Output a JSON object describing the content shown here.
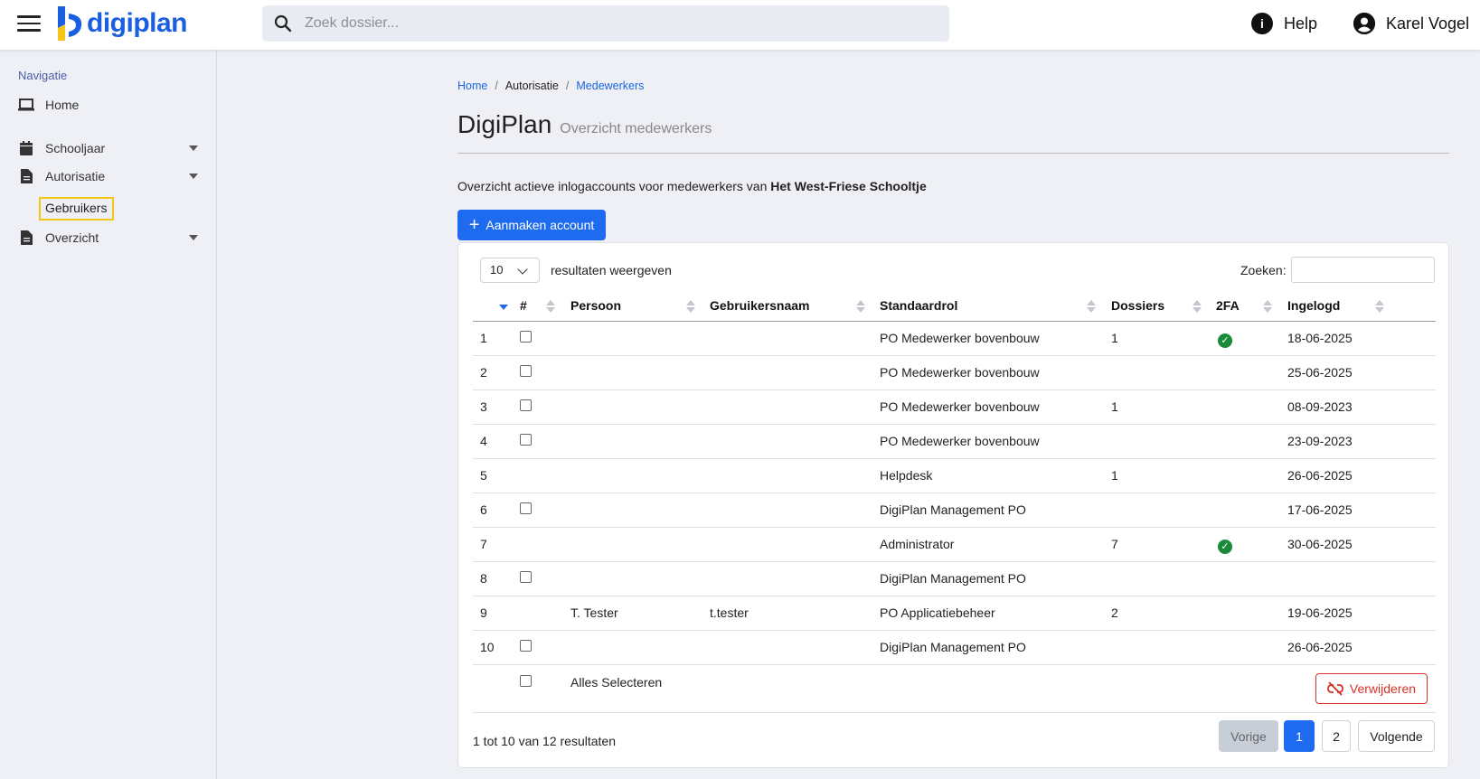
{
  "header": {
    "logo_text": "digiplan",
    "search_placeholder": "Zoek dossier...",
    "help_label": "Help",
    "user_name": "Karel Vogel"
  },
  "sidebar": {
    "heading": "Navigatie",
    "items": [
      {
        "label": "Home",
        "icon": "laptop-icon"
      },
      {
        "label": "Schooljaar",
        "icon": "calendar-icon"
      },
      {
        "label": "Autorisatie",
        "icon": "document-icon"
      },
      {
        "label": "Overzicht",
        "icon": "document-icon"
      }
    ],
    "sub_item": "Gebruikers"
  },
  "breadcrumb": {
    "home": "Home",
    "sep": "/",
    "auth": "Autorisatie",
    "current": "Medewerkers"
  },
  "page": {
    "title": "DigiPlan",
    "subtitle": "Overzicht medewerkers",
    "intro": "Overzicht actieve inlogaccounts voor medewerkers van ",
    "school": "Het West-Friese Schooltje",
    "create_button": "Aanmaken account"
  },
  "table": {
    "length_value": "10",
    "length_label": "resultaten weergeven",
    "search_label": "Zoeken:",
    "headers": {
      "hash": "#",
      "persoon": "Persoon",
      "gebruikersnaam": "Gebruikersnaam",
      "standaardrol": "Standaardrol",
      "dossiers": "Dossiers",
      "twofa": "2FA",
      "ingelogd": "Ingelogd"
    },
    "rows": [
      {
        "nr": "1",
        "checkbox": true,
        "persoon": "",
        "gebruikersnaam": "",
        "rol": "PO Medewerker bovenbouw",
        "dossiers": "1",
        "twofa": true,
        "ingelogd": "18-06-2025"
      },
      {
        "nr": "2",
        "checkbox": true,
        "persoon": "",
        "gebruikersnaam": "",
        "rol": "PO Medewerker bovenbouw",
        "dossiers": "",
        "twofa": false,
        "ingelogd": "25-06-2025"
      },
      {
        "nr": "3",
        "checkbox": true,
        "persoon": "",
        "gebruikersnaam": "",
        "rol": "PO Medewerker bovenbouw",
        "dossiers": "1",
        "twofa": false,
        "ingelogd": "08-09-2023"
      },
      {
        "nr": "4",
        "checkbox": true,
        "persoon": "",
        "gebruikersnaam": "",
        "rol": "PO Medewerker bovenbouw",
        "dossiers": "",
        "twofa": false,
        "ingelogd": "23-09-2023"
      },
      {
        "nr": "5",
        "checkbox": false,
        "persoon": "",
        "gebruikersnaam": "",
        "rol": "Helpdesk",
        "dossiers": "1",
        "twofa": false,
        "ingelogd": "26-06-2025"
      },
      {
        "nr": "6",
        "checkbox": true,
        "persoon": "",
        "gebruikersnaam": "",
        "rol": "DigiPlan Management PO",
        "dossiers": "",
        "twofa": false,
        "ingelogd": "17-06-2025"
      },
      {
        "nr": "7",
        "checkbox": false,
        "persoon": "",
        "gebruikersnaam": "",
        "rol": "Administrator",
        "dossiers": "7",
        "twofa": true,
        "ingelogd": "30-06-2025"
      },
      {
        "nr": "8",
        "checkbox": true,
        "persoon": "",
        "gebruikersnaam": "",
        "rol": "DigiPlan Management PO",
        "dossiers": "",
        "twofa": false,
        "ingelogd": ""
      },
      {
        "nr": "9",
        "checkbox": false,
        "persoon": "T. Tester",
        "gebruikersnaam": "t.tester",
        "rol": "PO Applicatiebeheer",
        "dossiers": "2",
        "twofa": false,
        "ingelogd": "19-06-2025"
      },
      {
        "nr": "10",
        "checkbox": true,
        "persoon": "",
        "gebruikersnaam": "",
        "rol": "DigiPlan Management PO",
        "dossiers": "",
        "twofa": false,
        "ingelogd": "26-06-2025"
      }
    ],
    "select_all": "Alles Selecteren",
    "delete_button": "Verwijderen",
    "info": "1 tot 10 van 12 resultaten",
    "pagination": {
      "prev": "Vorige",
      "page1": "1",
      "page2": "2",
      "next": "Volgende"
    }
  },
  "colors": {
    "accent": "#1f6bf0",
    "danger": "#d93025",
    "success": "#1b8b3a",
    "highlight": "#f5c518"
  }
}
